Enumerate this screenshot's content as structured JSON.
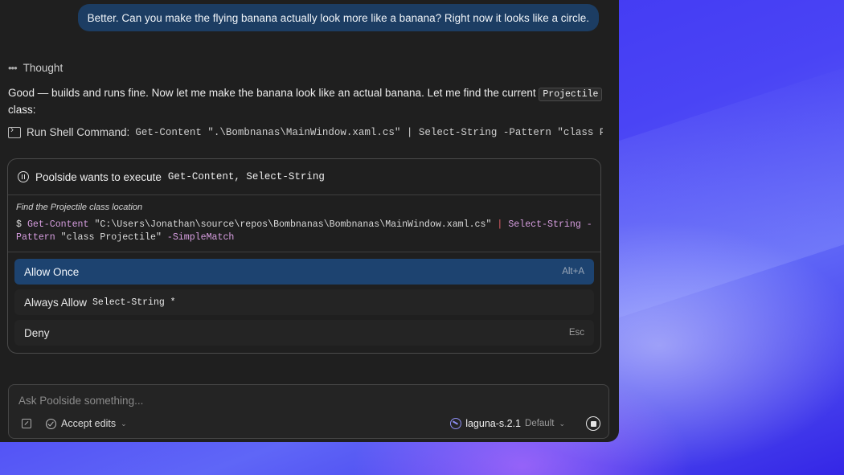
{
  "chat": {
    "user_message": "Better. Can you make the flying banana actually look more like a banana? Right now it looks like a circle.",
    "thought_label": "Thought",
    "reply_text_1": "Good — builds and runs fine. Now let me make the banana look like an actual banana. Let me find the current ",
    "reply_code": "Projectile",
    "reply_text_2": " class:",
    "shell_label": "Run Shell Command:",
    "shell_command": "Get-Content \".\\Bombnanas\\MainWindow.xaml.cs\" | Select-String -Pattern \"class P…"
  },
  "permission": {
    "title_prefix": "Poolside wants to execute",
    "title_commands": "Get-Content, Select-String",
    "description": "Find the Projectile class location",
    "prompt": "$",
    "cmd1": "Get-Content",
    "arg1": "\"C:\\Users\\Jonathan\\source\\repos\\Bombnanas\\Bombnanas\\MainWindow.xaml.cs\"",
    "pipe": "|",
    "cmd2": "Select-String",
    "flag1": "-Pattern",
    "arg2": "\"class Projectile\"",
    "flag2": "-SimpleMatch",
    "options": {
      "allow_once": "Allow Once",
      "allow_once_shortcut": "Alt+A",
      "always_allow": "Always Allow",
      "always_allow_pattern": "Select-String *",
      "deny": "Deny",
      "deny_shortcut": "Esc"
    }
  },
  "input": {
    "placeholder": "Ask Poolside something...",
    "accept_edits": "Accept edits",
    "model_name": "laguna-s.2.1",
    "model_mode": "Default"
  },
  "colors": {
    "accent_button": "#1d4370",
    "user_bubble": "#1c3d63",
    "panel_bg": "#1f1f1f",
    "desktop": "#3a33f2"
  }
}
